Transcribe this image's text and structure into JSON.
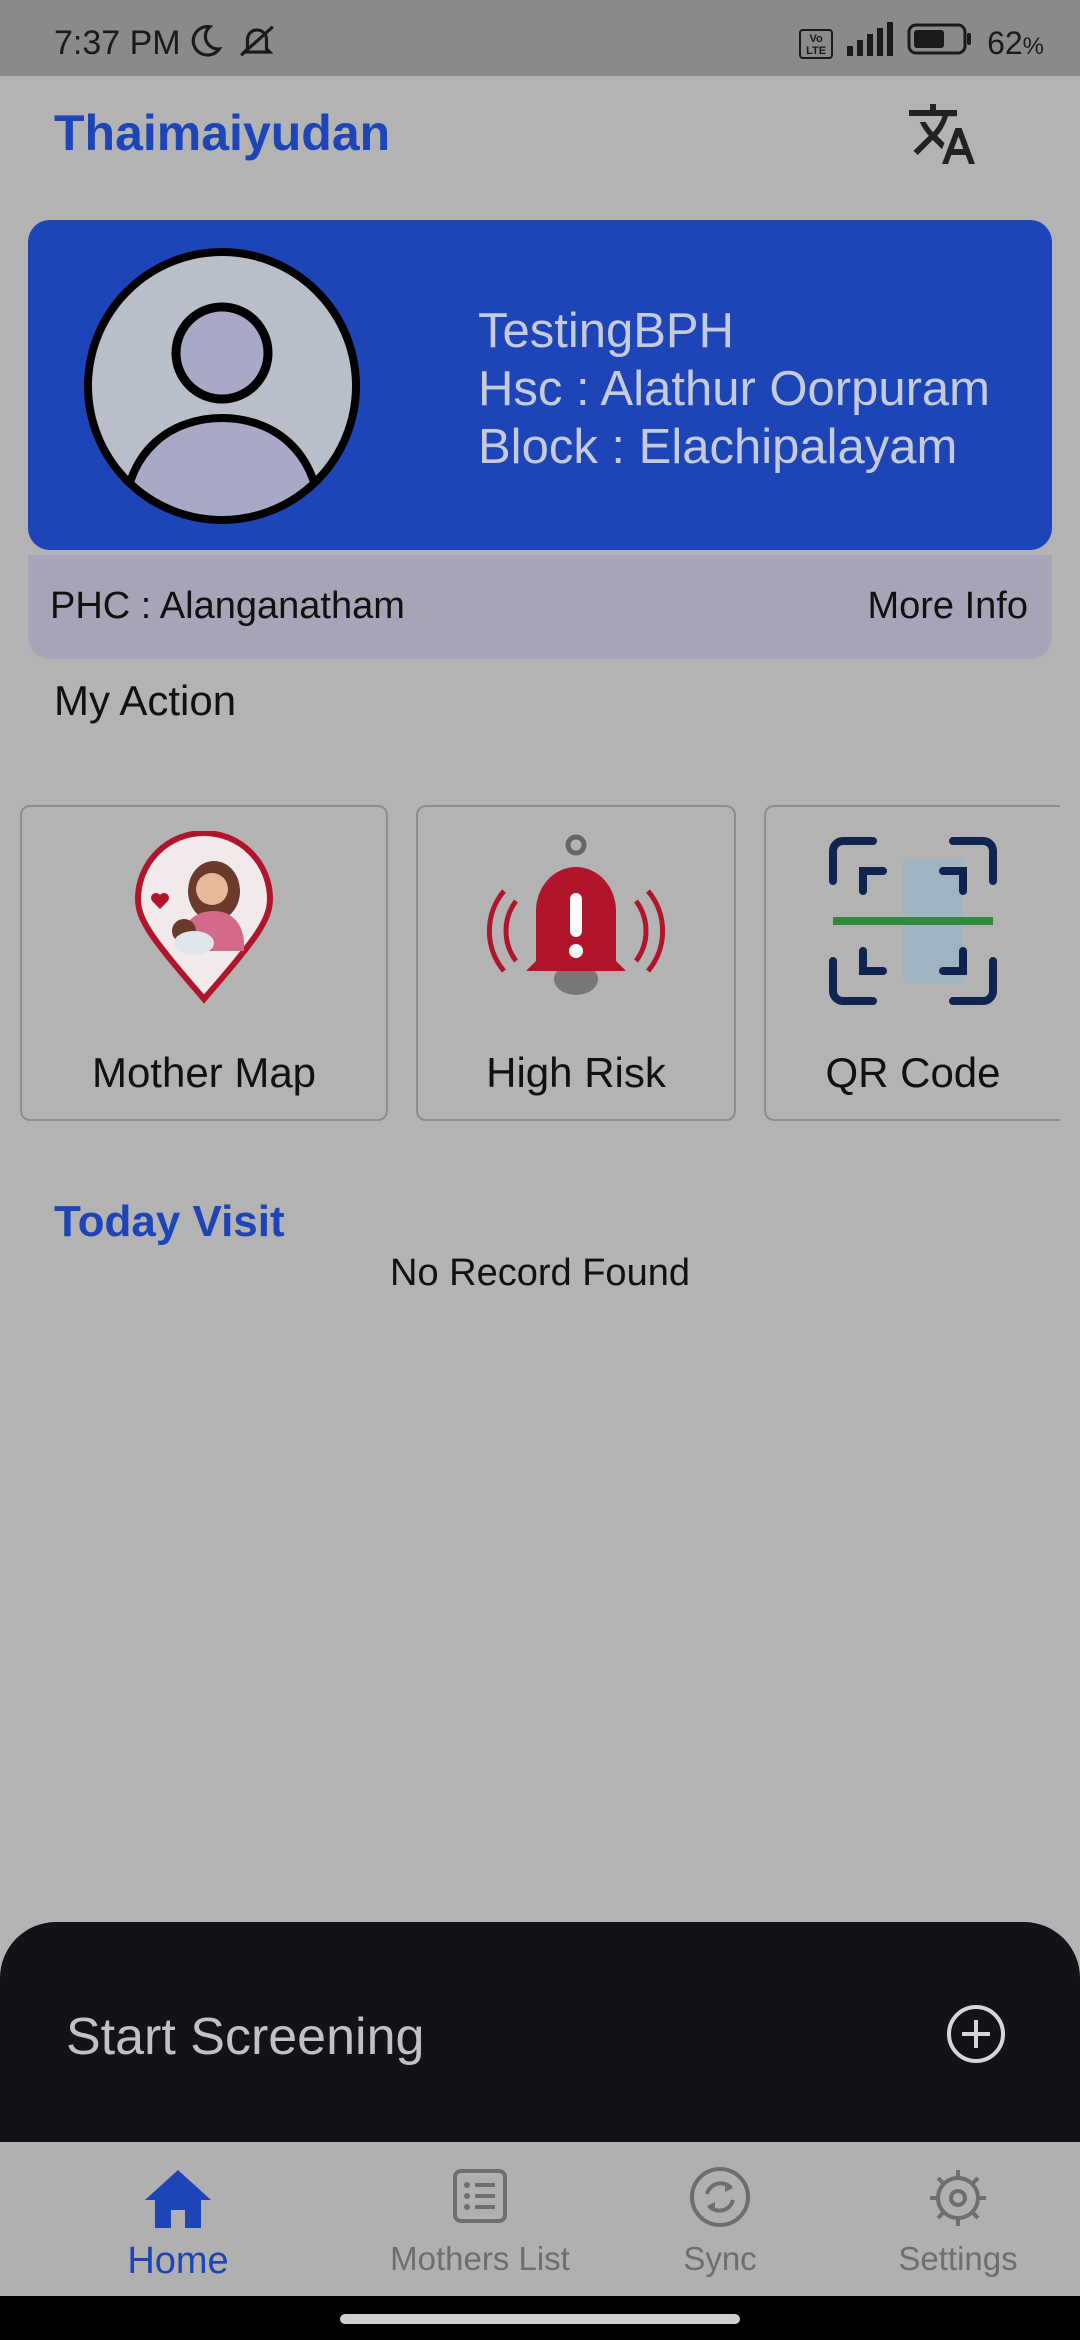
{
  "status_bar": {
    "time": "7:37 PM",
    "battery_pct": "62",
    "battery_unit": "%",
    "network_badge_top": "Vo",
    "network_badge_bottom": "LTE",
    "icons": [
      "moon-icon",
      "muted-bell-icon",
      "volte-icon",
      "signal-icon",
      "battery-icon"
    ]
  },
  "app": {
    "title": "Thaimaiyudan",
    "translate_icon": "translate-icon"
  },
  "profile": {
    "name": "TestingBPH",
    "hsc": "Hsc : Alathur Oorpuram",
    "block": "Block : Elachipalayam",
    "phc": "PHC : Alanganatham",
    "more_info": "More Info"
  },
  "my_action": {
    "title": "My Action",
    "items": [
      {
        "label": "Mother Map",
        "icon": "mother-map-pin-icon"
      },
      {
        "label": "High Risk",
        "icon": "alarm-bell-icon"
      },
      {
        "label": "QR Code",
        "icon": "qr-scan-icon"
      }
    ]
  },
  "today_visit": {
    "title": "Today Visit",
    "empty_text": "No Record Found"
  },
  "screening": {
    "label": "Start Screening",
    "icon": "plus-circle-icon"
  },
  "bottom_nav": {
    "items": [
      {
        "label": "Home",
        "icon": "home-icon",
        "active": true
      },
      {
        "label": "Mothers List",
        "icon": "list-icon",
        "active": false
      },
      {
        "label": "Sync",
        "icon": "sync-icon",
        "active": false
      },
      {
        "label": "Settings",
        "icon": "gear-icon",
        "active": false
      }
    ]
  },
  "colors": {
    "brand_blue": "#1d45b8",
    "background_dim": "#b3b3b3",
    "sheet_dark": "#121317",
    "alert_red": "#b0152b"
  }
}
